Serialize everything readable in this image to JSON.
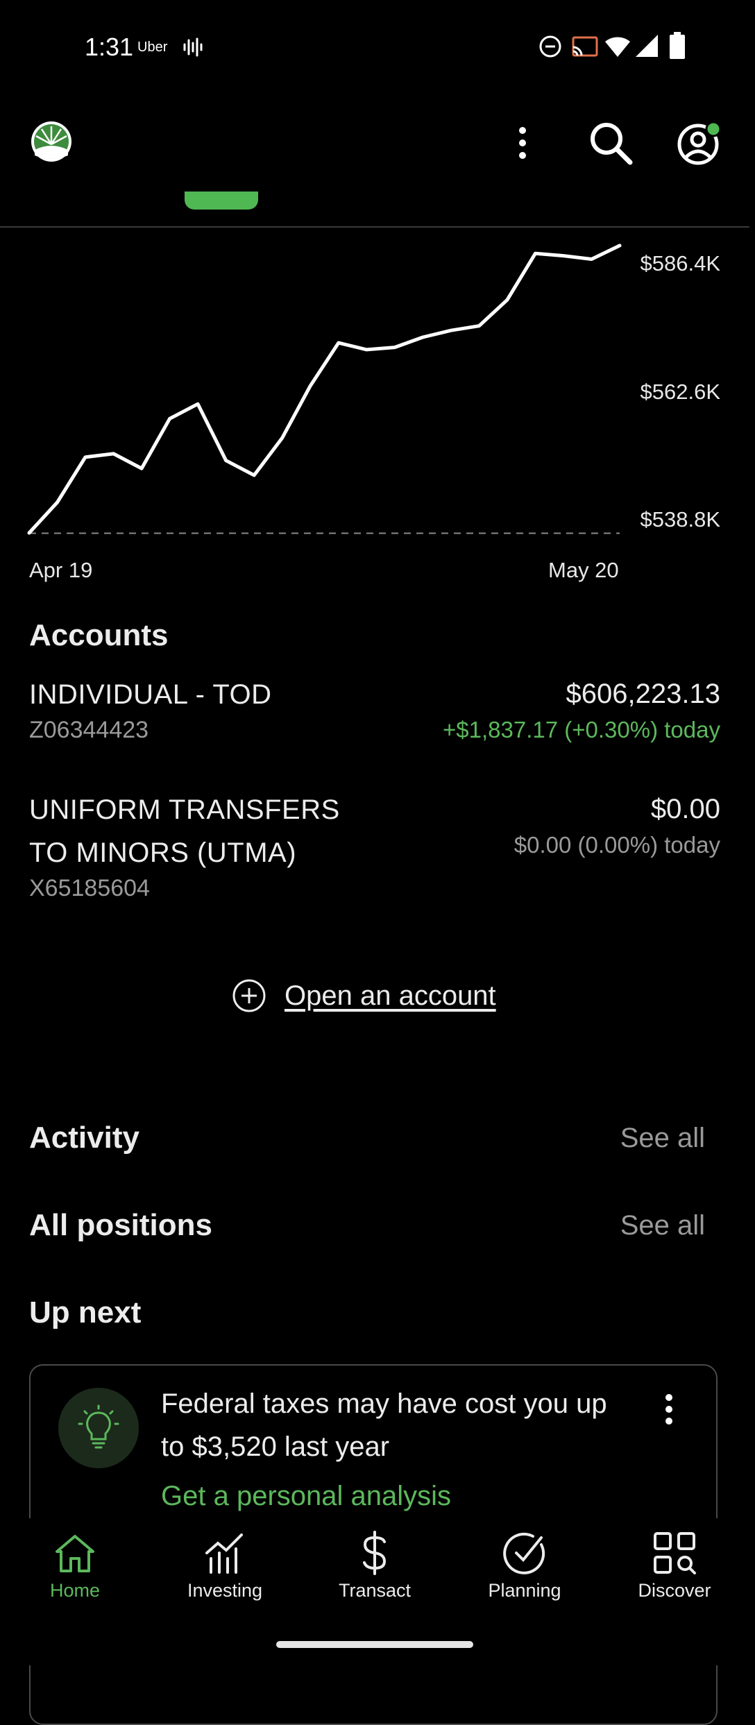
{
  "status_bar": {
    "time": "1:31",
    "app_label": "Uber",
    "icons": [
      "sound-wave-icon",
      "do-not-disturb-icon",
      "cast-icon",
      "wifi-icon",
      "signal-icon",
      "battery-icon"
    ]
  },
  "header": {
    "logo": "fidelity-logo",
    "menu_icon": "more-vert-icon",
    "search_icon": "search-icon",
    "profile_icon": "profile-icon",
    "profile_badge_color": "#4fb853",
    "active_tab_indicator_color": "#4fb853"
  },
  "chart": {
    "y_labels": [
      "$586.4K",
      "$562.6K",
      "$538.8K"
    ],
    "x_labels": [
      "Apr 19",
      "May 20"
    ]
  },
  "chart_data": {
    "type": "line",
    "x_range": [
      "Apr 19",
      "May 20"
    ],
    "ylim": [
      538.8,
      586.4
    ],
    "y_unit": "$K",
    "series": [
      {
        "values": [
          538.8,
          544.2,
          552.2,
          552.8,
          550.2,
          559.0,
          561.6,
          551.6,
          549.0,
          555.6,
          564.8,
          572.4,
          571.2,
          571.6,
          573.4,
          574.6,
          575.4,
          580.0,
          588.2,
          587.8,
          587.2,
          589.6
        ]
      }
    ],
    "baseline_value": 538.8,
    "grid": false,
    "line_color": "#ffffff"
  },
  "accounts": {
    "title": "Accounts",
    "items": [
      {
        "name": "INDIVIDUAL - TOD",
        "number": "Z06344423",
        "balance": "$606,223.13",
        "change": "+$1,837.17 (+0.30%) today"
      },
      {
        "name_line1": "UNIFORM TRANSFERS",
        "name_line2": "TO MINORS (UTMA)",
        "number": "X65185604",
        "balance": "$0.00",
        "change": "$0.00 (0.00%) today"
      }
    ],
    "open_account_label": "Open an account"
  },
  "activity": {
    "title": "Activity",
    "see_all": "See all"
  },
  "positions": {
    "title": "All positions",
    "see_all": "See all"
  },
  "up_next": {
    "title": "Up next",
    "card_title": "Federal taxes may have cost you up to $3,520 last year",
    "card_link": "Get a personal analysis",
    "card_icon": "lightbulb-icon"
  },
  "bottom_nav": {
    "items": [
      {
        "label": "Home",
        "icon": "home-icon",
        "active": true
      },
      {
        "label": "Investing",
        "icon": "chart-icon",
        "active": false
      },
      {
        "label": "Transact",
        "icon": "dollar-icon",
        "active": false
      },
      {
        "label": "Planning",
        "icon": "check-circle-icon",
        "active": false
      },
      {
        "label": "Discover",
        "icon": "grid-search-icon",
        "active": false
      }
    ]
  },
  "colors": {
    "accent": "#4fb853",
    "positive": "#5cb85c",
    "muted": "#9a9a9a",
    "background": "#000000"
  }
}
